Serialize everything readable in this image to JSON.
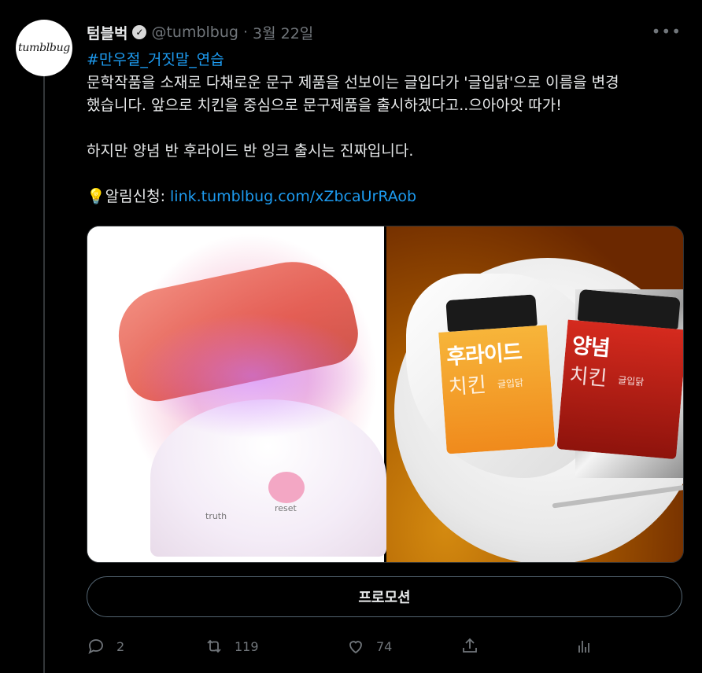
{
  "author": {
    "avatar_text": "tumblbug",
    "name": "텀블벅",
    "handle": "@tumblbug",
    "separator": "·",
    "date": "3월 22일",
    "more_label": "•••"
  },
  "tweet": {
    "hashtag": "#만우절_거짓말_연습",
    "line1": "문학작품을 소재로 다채로운 문구 제품을 선보이는 글입다가 '글입닭'으로 이름을 변경",
    "line2": "했습니다. 앞으로 치킨을 중심으로 문구제품을 출시하겠다고..으아아앗 따가!",
    "line3": "하지만 양념 반 후라이드 반 잉크 출시는 진짜입니다.",
    "notice_label": "💡알림신청: ",
    "link": "link.tumblbug.com/xZbcaUrRAob"
  },
  "media": {
    "left_labels": [
      "truth",
      "reset"
    ],
    "jar1_title": "후라이드",
    "jar1_sub": "치킨",
    "jar1_brand": "글입닭",
    "jar2_title": "양념",
    "jar2_sub": "치킨",
    "jar2_brand": "글입닭"
  },
  "promo_label": "프로모션",
  "actions": {
    "reply_count": "2",
    "retweet_count": "119",
    "like_count": "74"
  },
  "colors": {
    "background": "#000000",
    "text": "#e7e9ea",
    "muted": "#71767b",
    "accent": "#1d9bf0"
  }
}
